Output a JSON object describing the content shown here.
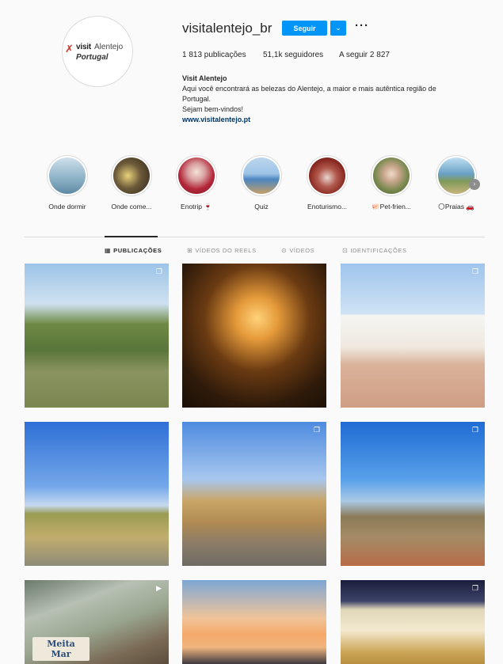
{
  "profile": {
    "username": "visitalentejo_br",
    "follow_label": "Seguir",
    "dropdown_icon": "chevron-down-icon",
    "more_icon": "more-options-icon",
    "logo": {
      "line1": "visit",
      "line1b": "Alentejo",
      "line2": "Portugal"
    },
    "stats": {
      "posts": "1 813 publicações",
      "followers": "51,1k seguidores",
      "following": "A seguir 2 827"
    },
    "bio": {
      "name": "Visit Alentejo",
      "line1": "Aqui você encontrará as belezas do Alentejo, a maior e mais autêntica região de",
      "line2": "Portugal.",
      "line3": "Sejam bem-vindos!",
      "link": "www.visitalentejo.pt"
    }
  },
  "highlights": [
    {
      "label": "Onde dormir",
      "color": "#8fb4c9"
    },
    {
      "label": "Onde come...",
      "color": "#6c5a3a"
    },
    {
      "label": "Enotrip 🍷",
      "color": "#b3283a"
    },
    {
      "label": "Quiz",
      "color": "#4b86c0"
    },
    {
      "label": "Enoturismo...",
      "color": "#8a2a22"
    },
    {
      "label": "🐖Pet-frien...",
      "color": "#7a8a50"
    },
    {
      "label": "🌕Praias 🚗",
      "color": "#6aa0c4"
    }
  ],
  "tabs": [
    {
      "label": "PUBLICAÇÕES",
      "icon": "grid-icon",
      "active": true
    },
    {
      "label": "VÍDEOS DO REELS",
      "icon": "reels-icon",
      "active": false
    },
    {
      "label": "VÍDEOS",
      "icon": "video-icon",
      "active": false
    },
    {
      "label": "IDENTIFICAÇÕES",
      "icon": "tag-icon",
      "active": false
    }
  ],
  "posts": [
    {
      "type": "carousel"
    },
    {
      "type": "photo"
    },
    {
      "type": "carousel"
    },
    {
      "type": "photo"
    },
    {
      "type": "carousel"
    },
    {
      "type": "carousel"
    },
    {
      "type": "reel",
      "overlay_text": "Meita Mar"
    },
    {
      "type": "photo"
    },
    {
      "type": "carousel"
    }
  ]
}
